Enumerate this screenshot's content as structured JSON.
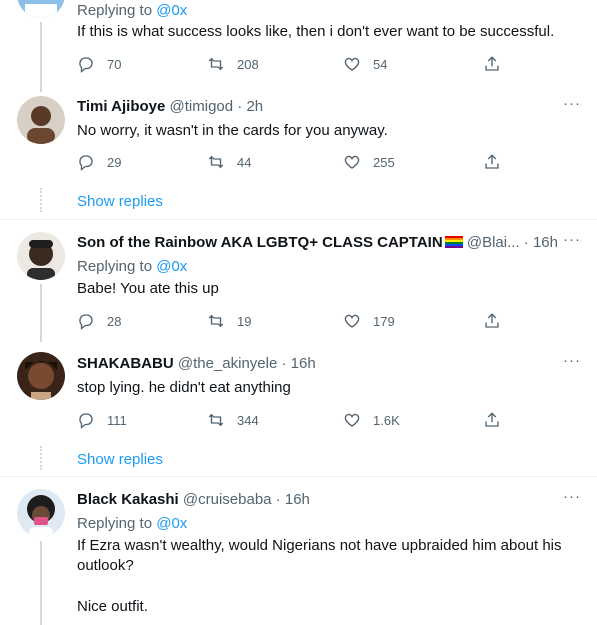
{
  "tweets": [
    {
      "replying_prefix": "Replying to ",
      "replying_to": "@0x",
      "text": "If this is what success looks like, then i don't ever want to be successful.",
      "replies": "70",
      "retweets": "208",
      "likes": "54"
    },
    {
      "name": "Timi Ajiboye",
      "handle": "@timigod",
      "sep": " · ",
      "time": "2h",
      "more": "···",
      "text": "No worry, it wasn't in the cards for you anyway.",
      "replies": "29",
      "retweets": "44",
      "likes": "255",
      "show_replies": "Show replies"
    },
    {
      "name": "Son of the Rainbow AKA LGBTQ+ CLASS CAPTAIN",
      "emoji": "rainbow-flag",
      "handle": "@Blai...",
      "sep": " · ",
      "time": "16h",
      "more": "···",
      "replying_prefix": "Replying to ",
      "replying_to": "@0x",
      "text": "Babe! You ate this up",
      "replies": "28",
      "retweets": "19",
      "likes": "179"
    },
    {
      "name": "SHAKABABU",
      "handle": "@the_akinyele",
      "sep": " · ",
      "time": "16h",
      "more": "···",
      "text": "stop lying. he didn't eat anything",
      "replies": "111",
      "retweets": "344",
      "likes": "1.6K",
      "show_replies": "Show replies"
    },
    {
      "name": "Black Kakashi",
      "handle": "@cruisebaba",
      "sep": " · ",
      "time": "16h",
      "more": "···",
      "replying_prefix": "Replying to ",
      "replying_to": "@0x",
      "text": "If Ezra wasn't wealthy, would Nigerians not have upbraided him about his outlook?",
      "text2": "Nice outfit."
    }
  ],
  "colors": {
    "accent": "#1d9bf0",
    "secondary_text": "#536471",
    "divider": "#eff3f4"
  },
  "icons": [
    "reply-icon",
    "retweet-icon",
    "like-icon",
    "share-icon",
    "more-icon"
  ]
}
